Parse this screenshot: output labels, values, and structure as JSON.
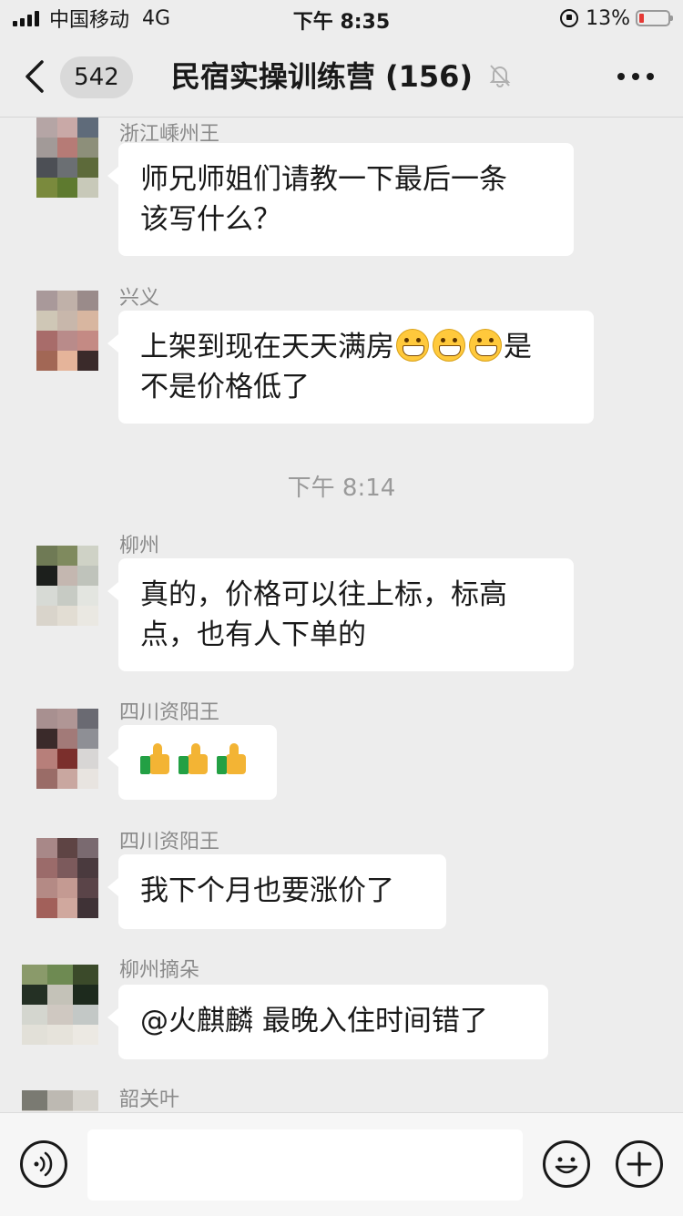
{
  "status": {
    "carrier": "中国移动",
    "network": "4G",
    "time": "下午 8:35",
    "battery": "13%"
  },
  "nav": {
    "back_count": "542",
    "title": "民宿实操训练营 (156)"
  },
  "messages": [
    {
      "sender": "浙江嵊州王",
      "text_lines": [
        "师兄师姐们请教一下最后一条",
        "该写什么？"
      ]
    },
    {
      "sender": "兴义",
      "text_line1": "上架到现在天天满房",
      "text_line1_end": "是",
      "text_line2": "不是价格低了"
    },
    {
      "sender": "柳州",
      "text_lines": [
        "真的，价格可以往上标，标高",
        "点，也有人下单的"
      ]
    },
    {
      "sender": "四川资阳王",
      "text": ""
    },
    {
      "sender": "四川资阳王",
      "text": "我下个月也要涨价了"
    },
    {
      "sender": "柳州摘朵",
      "text": "@火麒麟 最晚入住时间错了"
    },
    {
      "sender": "韶关叶"
    }
  ],
  "timestamp": "下午 8:14",
  "icons": {
    "back": "chevron-left-icon",
    "mute": "bell-off-icon",
    "more": "ellipsis-icon",
    "voice": "voice-icon",
    "emoji": "smiley-icon",
    "plus": "plus-icon",
    "grin": "grinning-emoji",
    "thumbs": "thumbs-up-emoji"
  },
  "colors": {
    "background": "#ededed",
    "bubble": "#ffffff",
    "battery_low": "#e53935"
  }
}
